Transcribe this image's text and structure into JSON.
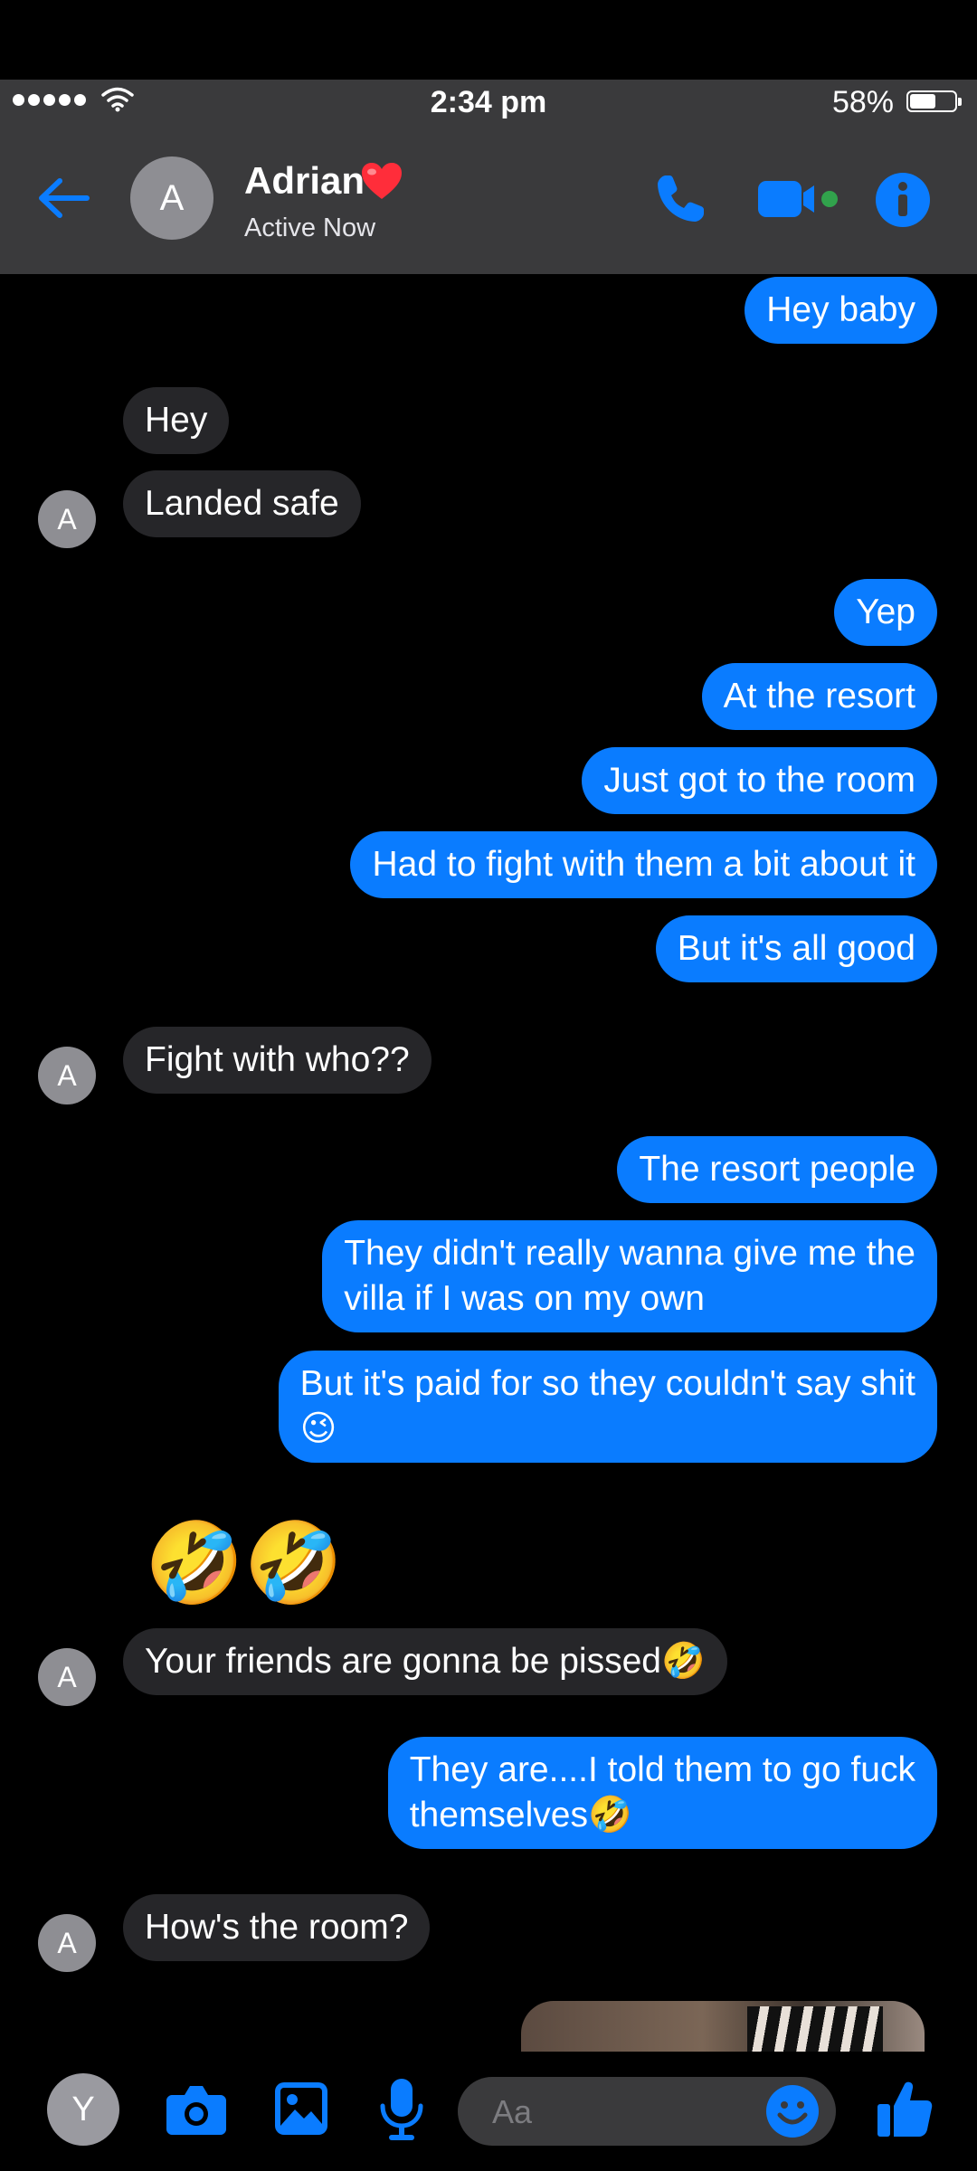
{
  "status_bar": {
    "time": "2:34 pm",
    "battery": "58%",
    "battery_level": 0.58
  },
  "header": {
    "contact_name": "Adrian",
    "heart": "❤️",
    "status": "Active Now",
    "avatar_initial": "A"
  },
  "icons": {
    "back": "back-arrow-icon",
    "phone": "phone-icon",
    "video": "video-camera-icon",
    "info": "info-icon",
    "camera": "camera-icon",
    "image": "image-icon",
    "mic": "microphone-icon",
    "emoji": "emoji-icon",
    "like": "thumbs-up-icon"
  },
  "colors": {
    "accent": "#0a7cff",
    "incoming_bubble": "#262629",
    "header_bg": "#3a3a3c",
    "active_dot": "#31a24c"
  },
  "messages": [
    {
      "from": "me",
      "text": "Hey baby"
    },
    {
      "from": "them",
      "text": "Hey"
    },
    {
      "from": "them",
      "text": "Landed safe"
    },
    {
      "from": "me",
      "text": "Yep"
    },
    {
      "from": "me",
      "text": "At the resort"
    },
    {
      "from": "me",
      "text": "Just got to the room"
    },
    {
      "from": "me",
      "text": "Had to fight with them a bit about it"
    },
    {
      "from": "me",
      "text": "But it's all good"
    },
    {
      "from": "them",
      "text": "Fight with who??"
    },
    {
      "from": "me",
      "text": "The resort people"
    },
    {
      "from": "me",
      "text_lines": [
        "They didn't really wanna give me the",
        "villa if I was on my own"
      ]
    },
    {
      "from": "me",
      "text_lines": [
        "But it's paid for so they couldn't say shit",
        "😉"
      ]
    },
    {
      "from": "them",
      "text": "🤣🤣"
    },
    {
      "from": "them",
      "text": "Your friends are gonna be pissed🤣"
    },
    {
      "from": "me",
      "text_lines": [
        "They are....I told them to go fuck",
        "themselves🤣"
      ]
    },
    {
      "from": "them",
      "text": "How's the room?"
    }
  ],
  "message_avatar_initial": "A",
  "composer": {
    "placeholder": "Aa",
    "user_initial": "Y"
  }
}
